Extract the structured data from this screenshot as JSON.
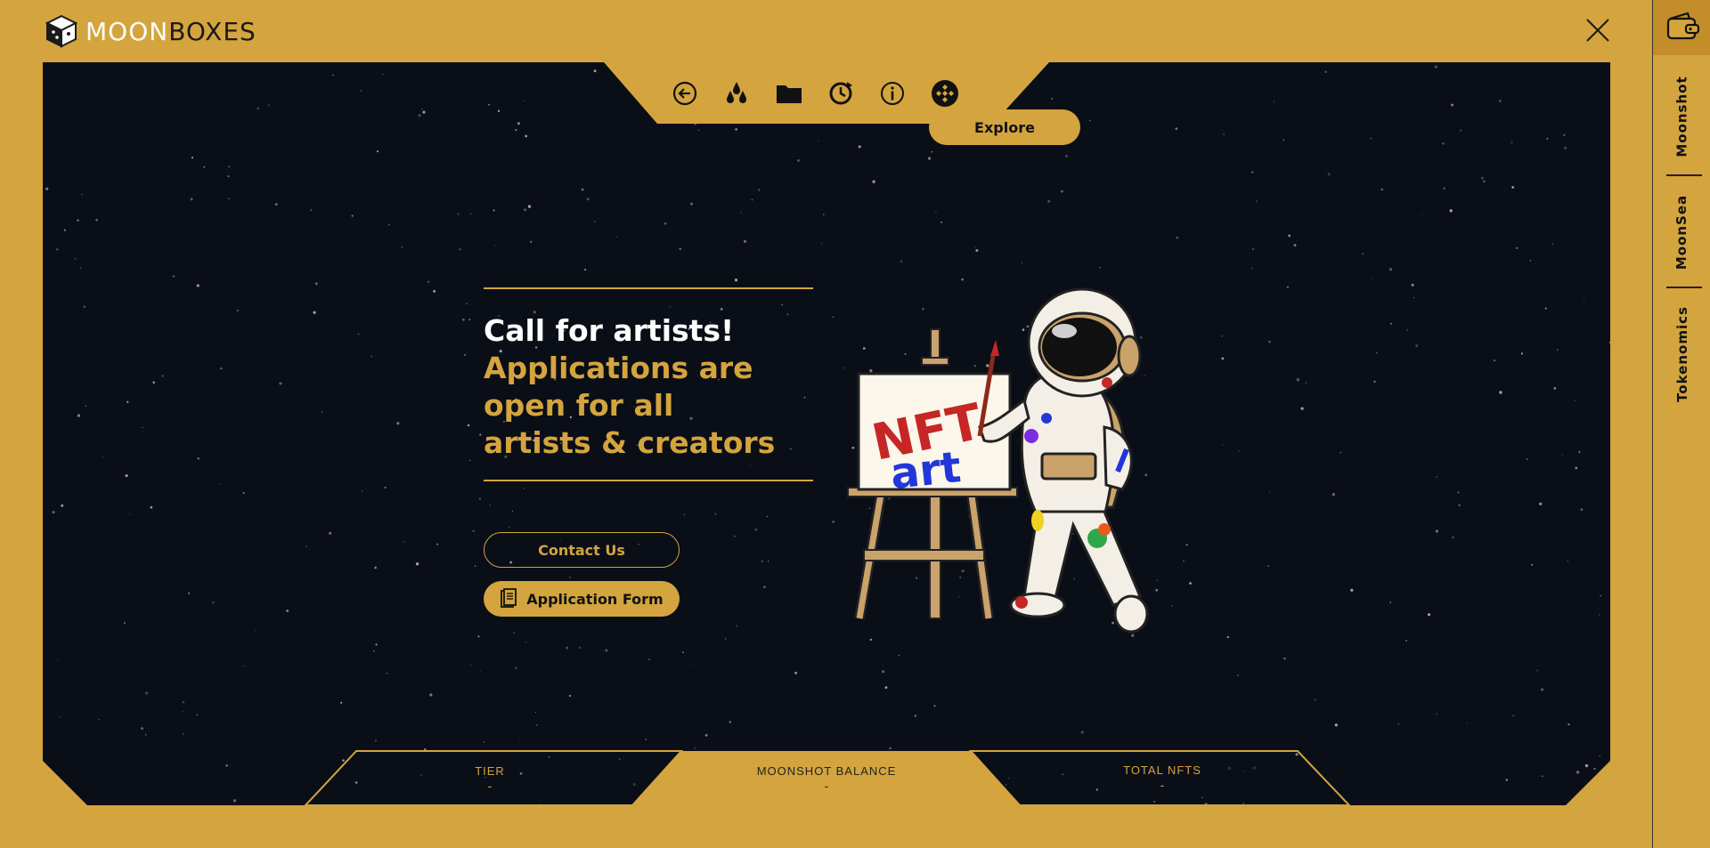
{
  "brand": {
    "moon": "MOON",
    "boxes": "BOXES"
  },
  "toolbar": {
    "icons": [
      "back-arrow-icon",
      "drops-icon",
      "folder-icon",
      "history-icon",
      "info-icon",
      "binance-icon"
    ],
    "explore_label": "Explore"
  },
  "hero": {
    "line1": "Call for artists!",
    "line2": "Applications are",
    "line3": "open for all",
    "line4": "artists & creators"
  },
  "buttons": {
    "contact": "Contact Us",
    "application": "Application Form"
  },
  "artwork": {
    "nft": "NFT",
    "art": "art"
  },
  "stats": {
    "tier": {
      "label": "TIER",
      "value": "-"
    },
    "balance": {
      "label": "MOONSHOT BALANCE",
      "value": "-"
    },
    "total": {
      "label": "TOTAL NFTS",
      "value": "-"
    }
  },
  "sidebar": {
    "items": [
      {
        "label": "Moonshot"
      },
      {
        "label": "MoonSea"
      },
      {
        "label": "Tokenomics"
      }
    ]
  },
  "colors": {
    "accent": "#d4a43e",
    "screen": "#0a0e17",
    "text_light": "#ffffff"
  }
}
